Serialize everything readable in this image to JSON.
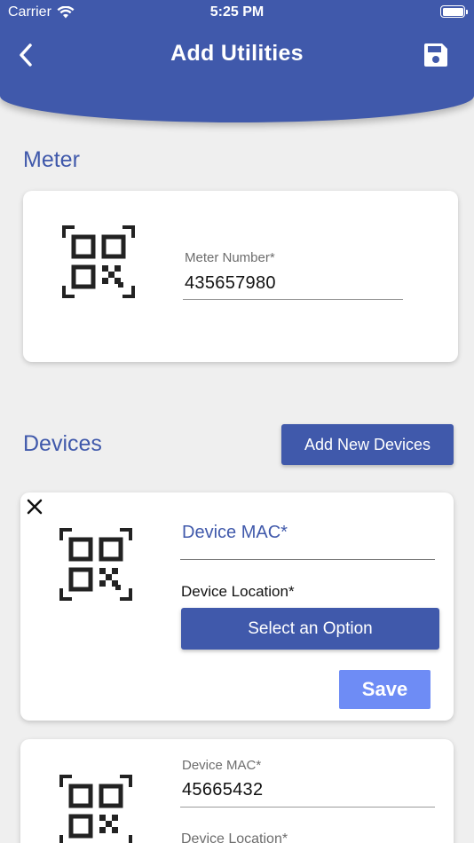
{
  "status_bar": {
    "carrier": "Carrier",
    "time": "5:25 PM"
  },
  "header": {
    "title": "Add Utilities",
    "back_icon": "chevron-left-icon",
    "save_icon": "floppy-disk-icon"
  },
  "meter": {
    "section_title": "Meter",
    "field_label": "Meter Number*",
    "field_value": "435657980",
    "qr_icon": "qr-code-scan-icon"
  },
  "devices": {
    "section_title": "Devices",
    "add_button_label": "Add New Devices",
    "items": [
      {
        "mac_label": "Device MAC*",
        "mac_value": "",
        "location_label": "Device Location*",
        "select_label": "Select an Option",
        "save_label": "Save"
      },
      {
        "mac_label": "Device MAC*",
        "mac_value": "45665432",
        "location_label": "Device Location*"
      }
    ]
  },
  "colors": {
    "primary": "#4059ab",
    "save_button": "#6e8cf5",
    "background": "#efefef"
  }
}
